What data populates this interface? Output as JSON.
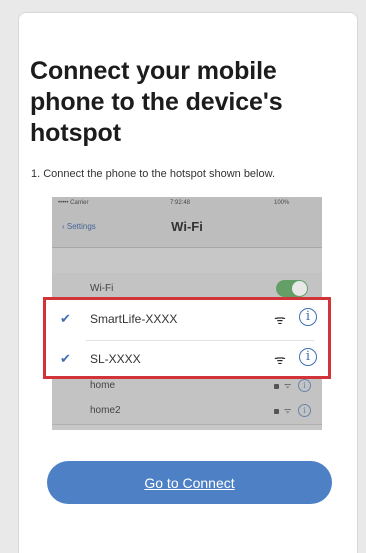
{
  "page": {
    "title": "Connect your mobile phone to the device's hotspot",
    "instruction": "1. Connect the phone to the hotspot shown below."
  },
  "phone_screenshot": {
    "status_bar": {
      "carrier": "••••• Carrier",
      "time": "7:92:48",
      "battery": "100%"
    },
    "nav": {
      "back_label": "Settings",
      "title": "Wi-Fi"
    },
    "wifi_row_label": "Wi-Fi",
    "wifi_toggle_on": true,
    "networks": [
      {
        "name": "SmartLife-XXXX",
        "selected": true
      },
      {
        "name": "SL-XXXX",
        "selected": true
      }
    ],
    "other_networks": [
      {
        "name": "home"
      },
      {
        "name": "home2"
      }
    ]
  },
  "actions": {
    "connect_label": "Go to Connect"
  },
  "colors": {
    "accent": "#4d80c4",
    "highlight": "#d23339"
  }
}
